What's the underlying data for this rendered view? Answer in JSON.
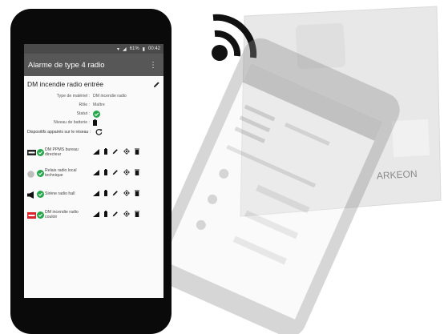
{
  "status_bar": {
    "battery": "61%",
    "time": "00:42"
  },
  "app_bar": {
    "title": "Alarme de type 4 radio",
    "menu_icon": "more-vert-icon"
  },
  "device": {
    "title": "DM incendie radio entrée",
    "edit_icon": "pencil-icon",
    "fields": [
      {
        "label": "Type de matériel :",
        "value": "DM incendie radio"
      },
      {
        "label": "Rôle :",
        "value": "Maître"
      },
      {
        "label": "Statut :",
        "value": ""
      },
      {
        "label": "Niveau de batterie :",
        "value": ""
      }
    ],
    "paired_label": "Dispositifs appairés sur le réseau :",
    "refresh_icon": "refresh-icon"
  },
  "paired_devices": [
    {
      "name": "DM PPMS bureau directeur",
      "icon": "ppms-box-icon",
      "status_color": "#25a84a"
    },
    {
      "name": "Relais radio local technique",
      "icon": "relay-icon",
      "status_color": "#25a84a"
    },
    {
      "name": "Sirène radio hall",
      "icon": "siren-icon",
      "status_color": "#25a84a"
    },
    {
      "name": "DM incendie radio couloir",
      "icon": "fire-callpoint-icon",
      "status_color": "#25a84a"
    }
  ],
  "colors": {
    "appbar": "#575757",
    "statusbar": "#4a4a4a",
    "ok": "#25a84a",
    "fire": "#d9232d"
  },
  "background": {
    "device_label": "ARKEON",
    "wifi_icon": "wifi-icon"
  }
}
